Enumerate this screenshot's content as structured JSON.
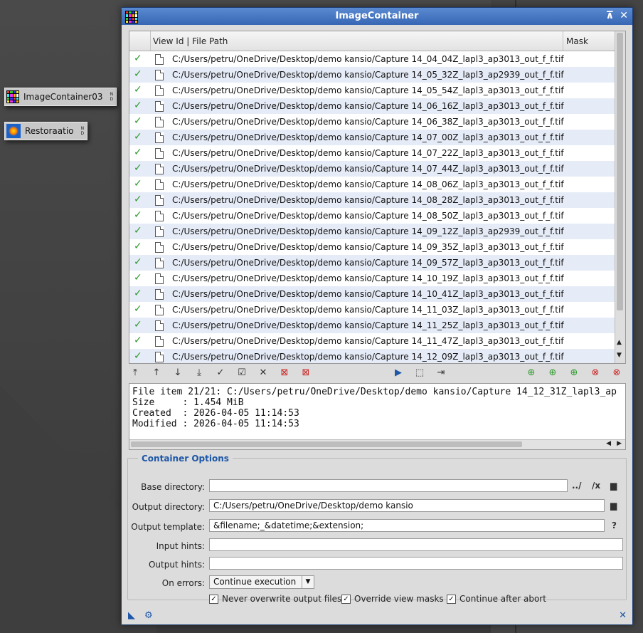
{
  "desktop": {
    "icons": [
      {
        "label": "ImageContainer03",
        "nd": [
          "N",
          "D"
        ]
      },
      {
        "label": "Restoraatio",
        "nd": [
          "N",
          "D"
        ]
      }
    ]
  },
  "window": {
    "title": "ImageContainer",
    "shade_glyph": "⊼",
    "close_glyph": "✕"
  },
  "table": {
    "col_view": "View Id | File Path",
    "col_mask": "Mask",
    "rows": [
      "C:/Users/petru/OneDrive/Desktop/demo kansio/Capture 14_04_04Z_lapl3_ap3013_out_f_f.tif",
      "C:/Users/petru/OneDrive/Desktop/demo kansio/Capture 14_05_32Z_lapl3_ap2939_out_f_f.tif",
      "C:/Users/petru/OneDrive/Desktop/demo kansio/Capture 14_05_54Z_lapl3_ap3013_out_f_f.tif",
      "C:/Users/petru/OneDrive/Desktop/demo kansio/Capture 14_06_16Z_lapl3_ap3013_out_f_f.tif",
      "C:/Users/petru/OneDrive/Desktop/demo kansio/Capture 14_06_38Z_lapl3_ap3013_out_f_f.tif",
      "C:/Users/petru/OneDrive/Desktop/demo kansio/Capture 14_07_00Z_lapl3_ap3013_out_f_f.tif",
      "C:/Users/petru/OneDrive/Desktop/demo kansio/Capture 14_07_22Z_lapl3_ap3013_out_f_f.tif",
      "C:/Users/petru/OneDrive/Desktop/demo kansio/Capture 14_07_44Z_lapl3_ap3013_out_f_f.tif",
      "C:/Users/petru/OneDrive/Desktop/demo kansio/Capture 14_08_06Z_lapl3_ap3013_out_f_f.tif",
      "C:/Users/petru/OneDrive/Desktop/demo kansio/Capture 14_08_28Z_lapl3_ap3013_out_f_f.tif",
      "C:/Users/petru/OneDrive/Desktop/demo kansio/Capture 14_08_50Z_lapl3_ap3013_out_f_f.tif",
      "C:/Users/petru/OneDrive/Desktop/demo kansio/Capture 14_09_12Z_lapl3_ap2939_out_f_f.tif",
      "C:/Users/petru/OneDrive/Desktop/demo kansio/Capture 14_09_35Z_lapl3_ap3013_out_f_f.tif",
      "C:/Users/petru/OneDrive/Desktop/demo kansio/Capture 14_09_57Z_lapl3_ap3013_out_f_f.tif",
      "C:/Users/petru/OneDrive/Desktop/demo kansio/Capture 14_10_19Z_lapl3_ap3013_out_f_f.tif",
      "C:/Users/petru/OneDrive/Desktop/demo kansio/Capture 14_10_41Z_lapl3_ap3013_out_f_f.tif",
      "C:/Users/petru/OneDrive/Desktop/demo kansio/Capture 14_11_03Z_lapl3_ap3013_out_f_f.tif",
      "C:/Users/petru/OneDrive/Desktop/demo kansio/Capture 14_11_25Z_lapl3_ap3013_out_f_f.tif",
      "C:/Users/petru/OneDrive/Desktop/demo kansio/Capture 14_11_47Z_lapl3_ap3013_out_f_f.tif",
      "C:/Users/petru/OneDrive/Desktop/demo kansio/Capture 14_12_09Z_lapl3_ap3013_out_f_f.tif"
    ]
  },
  "toolbar_icons": {
    "left": [
      {
        "name": "move-to-top-icon",
        "glyph": "⤒"
      },
      {
        "name": "move-up-icon",
        "glyph": "↑"
      },
      {
        "name": "move-down-icon",
        "glyph": "↓"
      },
      {
        "name": "move-to-bottom-icon",
        "glyph": "⤓"
      },
      {
        "name": "check-icon",
        "glyph": "✓"
      },
      {
        "name": "check-all-icon",
        "glyph": "☑"
      },
      {
        "name": "uncheck-icon",
        "glyph": "✕"
      },
      {
        "name": "remove-icon",
        "glyph": "⊠"
      },
      {
        "name": "remove-all-icon",
        "glyph": "⊠"
      }
    ],
    "center": [
      {
        "name": "execute-icon",
        "glyph": "▶"
      },
      {
        "name": "select-icon",
        "glyph": "⬚"
      },
      {
        "name": "export-icon",
        "glyph": "⇥"
      }
    ],
    "right": [
      {
        "name": "add-folder-icon",
        "glyph": "⊕"
      },
      {
        "name": "add-view-icon",
        "glyph": "⊕"
      },
      {
        "name": "add-file-icon",
        "glyph": "⊕"
      },
      {
        "name": "remove-folder-icon",
        "glyph": "⊗"
      },
      {
        "name": "remove-view-icon",
        "glyph": "⊗"
      }
    ],
    "colors": {
      "green": "#2c9a2c",
      "red": "#cc2222",
      "blue": "#1d57a8"
    }
  },
  "info": {
    "text": "File item 21/21: C:/Users/petru/OneDrive/Desktop/demo kansio/Capture 14_12_31Z_lapl3_ap\nSize     : 1.454 MiB\nCreated  : 2026-04-05 11:14:53\nModified : 2026-04-05 11:14:53"
  },
  "options": {
    "legend": "Container Options",
    "base_dir_label": "Base directory:",
    "base_dir_value": "",
    "base_btn_up": "../",
    "base_btn_clear": "/x",
    "output_dir_label": "Output directory:",
    "output_dir_value": "C:/Users/petru/OneDrive/Desktop/demo kansio",
    "output_template_label": "Output template:",
    "output_template_value": "&filename;_&datetime;&extension;",
    "help_glyph": "?",
    "input_hints_label": "Input hints:",
    "input_hints_value": "",
    "output_hints_label": "Output hints:",
    "output_hints_value": "",
    "on_errors_label": "On errors:",
    "on_errors_value": "Continue execution",
    "cb_never_overwrite": "Never overwrite output files",
    "cb_override_masks": "Override view masks",
    "cb_continue_abort": "Continue after abort",
    "check_glyph": "✓"
  }
}
